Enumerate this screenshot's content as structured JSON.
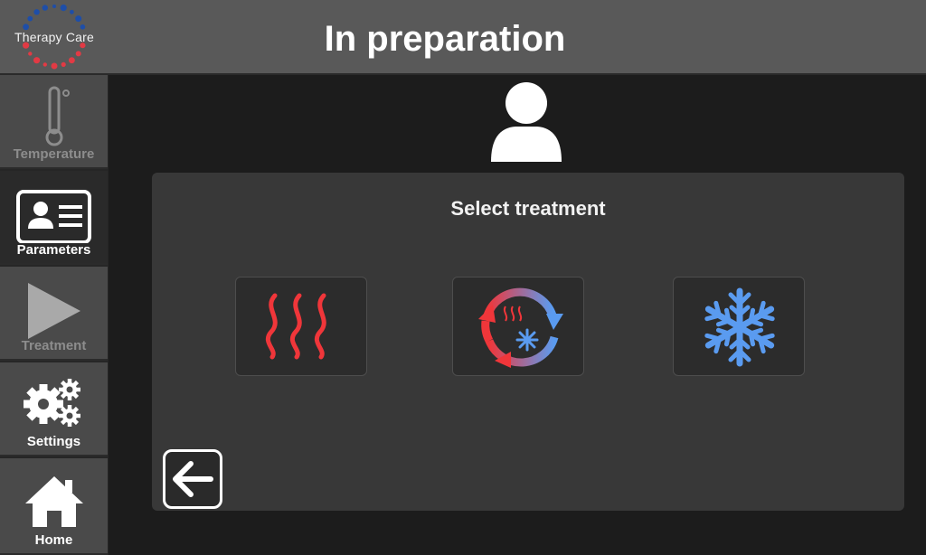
{
  "header": {
    "logo_text": "Therapy Care",
    "title": "In preparation"
  },
  "sidebar": {
    "items": [
      {
        "label": "Temperature",
        "icon": "thermometer-icon",
        "state": "disabled"
      },
      {
        "label": "Parameters",
        "icon": "id-card-icon",
        "state": "active"
      },
      {
        "label": "Treatment",
        "icon": "play-icon",
        "state": "disabled"
      },
      {
        "label": "Settings",
        "icon": "gears-icon",
        "state": "enabled"
      },
      {
        "label": "Home",
        "icon": "home-icon",
        "state": "enabled"
      }
    ]
  },
  "main": {
    "user_icon": "user-icon",
    "panel_title": "Select treatment",
    "treatments": [
      {
        "icon": "heat-waves-icon",
        "mode": "heat"
      },
      {
        "icon": "heat-cold-cycle-icon",
        "mode": "contrast"
      },
      {
        "icon": "snowflake-icon",
        "mode": "cold"
      }
    ],
    "back_icon": "arrow-left-icon"
  },
  "colors": {
    "header": "#595959",
    "background": "#1c1c1c",
    "panel": "#383838",
    "heat": "#f0363a",
    "cold": "#5a9bf0",
    "disabled_text": "#8d8d8d"
  }
}
